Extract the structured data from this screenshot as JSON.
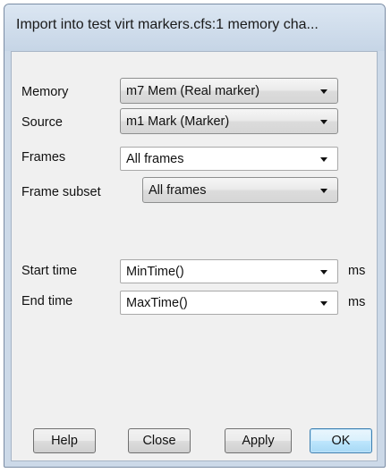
{
  "window": {
    "title": "Import into test virt markers.cfs:1 memory cha..."
  },
  "form": {
    "memory": {
      "label": "Memory",
      "value": "m7 Mem (Real marker)"
    },
    "source": {
      "label": "Source",
      "value": "m1 Mark (Marker)"
    },
    "frames": {
      "label": "Frames",
      "value": "All frames"
    },
    "frame_subset": {
      "label": "Frame subset",
      "value": "All frames"
    },
    "start_time": {
      "label": "Start time",
      "value": "MinTime()",
      "unit": "ms"
    },
    "end_time": {
      "label": "End time",
      "value": "MaxTime()",
      "unit": "ms"
    }
  },
  "buttons": {
    "help": "Help",
    "close": "Close",
    "apply": "Apply",
    "ok": "OK"
  }
}
